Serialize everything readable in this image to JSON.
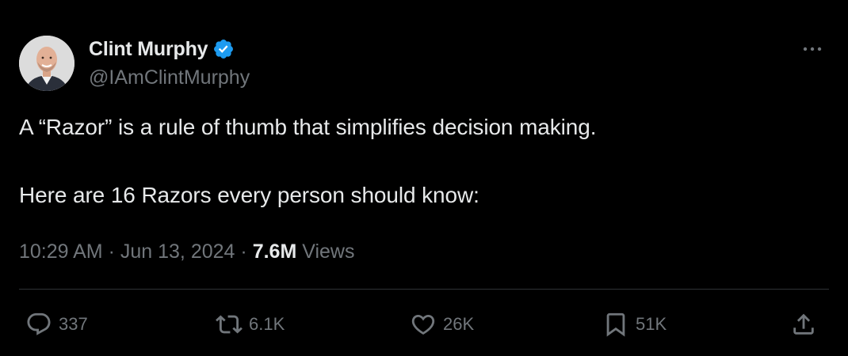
{
  "author": {
    "display_name": "Clint Murphy",
    "handle": "@IAmClintMurphy",
    "verified": true,
    "verified_color": "#1d9bf0"
  },
  "tweet": {
    "line1": "A “Razor” is a rule of thumb that simplifies decision making.",
    "line2": "Here are 16 Razors every person should know:"
  },
  "meta": {
    "time": "10:29 AM",
    "date": "Jun 13, 2024",
    "separator": "·",
    "views_count": "7.6M",
    "views_label": "Views"
  },
  "actions": {
    "replies": "337",
    "retweets": "6.1K",
    "likes": "26K",
    "bookmarks": "51K"
  },
  "icons": {
    "more": "more-horizontal-icon",
    "reply": "reply-icon",
    "retweet": "retweet-icon",
    "like": "heart-icon",
    "bookmark": "bookmark-icon",
    "share": "share-icon"
  },
  "colors": {
    "background": "#000000",
    "primary_text": "#e7e9ea",
    "secondary_text": "#71767b",
    "divider": "#2f3336"
  }
}
